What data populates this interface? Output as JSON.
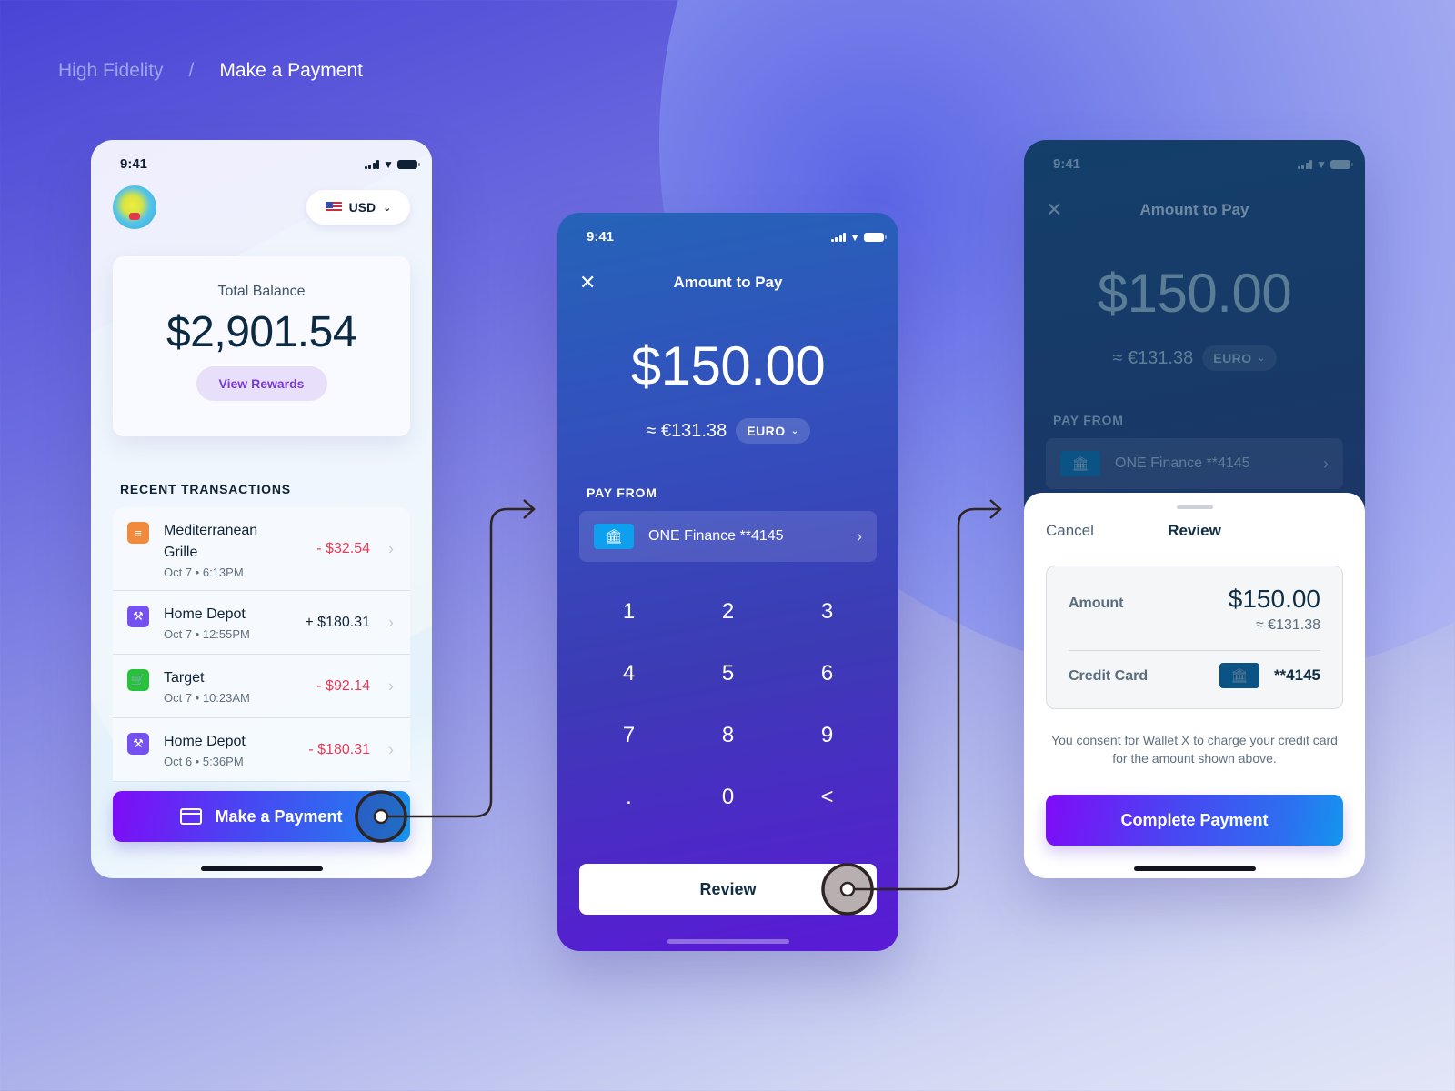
{
  "breadcrumb": {
    "parent": "High Fidelity",
    "separator": "/",
    "current": "Make a Payment"
  },
  "status_bar": {
    "time": "9:41"
  },
  "home_screen": {
    "currency": {
      "flag": "us-flag",
      "code": "USD"
    },
    "balance": {
      "label": "Total Balance",
      "value": "$2,901.54",
      "rewards_button": "View Rewards"
    },
    "recent_transactions": {
      "title": "RECENT TRANSACTIONS",
      "items": [
        {
          "icon": "burger-icon",
          "icon_color": "#f08a3c",
          "glyph": "≡",
          "name": "Mediterranean Grille",
          "date": "Oct 7 • 6:13PM",
          "amount": "- $32.54",
          "type": "debit"
        },
        {
          "icon": "hammer-icon",
          "icon_color": "#7552f0",
          "glyph": "⚒",
          "name": "Home Depot",
          "date": "Oct 7 • 12:55PM",
          "amount": "+ $180.31",
          "type": "credit"
        },
        {
          "icon": "cart-icon",
          "icon_color": "#27c23a",
          "glyph": "🛒",
          "name": "Target",
          "date": "Oct 7 • 10:23AM",
          "amount": "- $92.14",
          "type": "debit"
        },
        {
          "icon": "hammer-icon",
          "icon_color": "#7552f0",
          "glyph": "⚒",
          "name": "Home Depot",
          "date": "Oct 6 • 5:36PM",
          "amount": "- $180.31",
          "type": "debit"
        }
      ]
    },
    "pay_button": "Make a Payment"
  },
  "amount_screen": {
    "title": "Amount to Pay",
    "amount": "$150.00",
    "converted": "≈ €131.38",
    "currency_selector": "EURO",
    "pay_from_label": "PAY FROM",
    "account": "ONE Finance **4145",
    "keypad": [
      "1",
      "2",
      "3",
      "4",
      "5",
      "6",
      "7",
      "8",
      "9",
      ".",
      "0",
      "<"
    ],
    "review_button": "Review"
  },
  "review_sheet": {
    "cancel": "Cancel",
    "title": "Review",
    "amount_label": "Amount",
    "amount": "$150.00",
    "converted": "≈ €131.38",
    "card_label": "Credit Card",
    "card_last4": "**4145",
    "consent": "You consent for Wallet X to charge your credit card for the amount shown above.",
    "complete_button": "Complete Payment"
  },
  "colors": {
    "brand_gradient_start": "#7f0bf7",
    "brand_gradient_end": "#1495ee",
    "debit": "#ea3b54",
    "text_dark": "#0f2235",
    "bank_badge": "#0ea0ee"
  }
}
